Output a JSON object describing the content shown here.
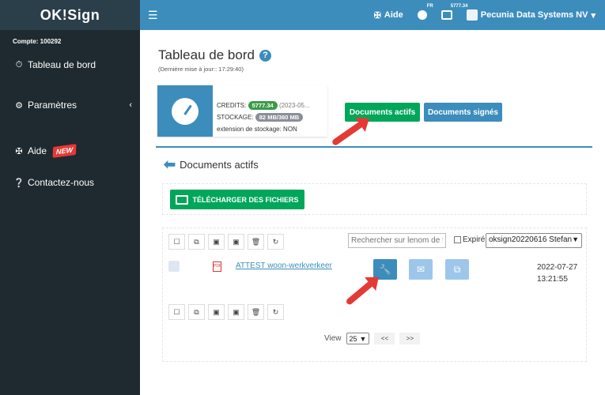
{
  "brand": "OK!Sign",
  "topbar": {
    "menu_icon": "hamburger-icon",
    "help_label": "Aide",
    "lang_sup": "FR",
    "credits_sup": "5777.34",
    "org_name": "Pecunia Data Systems NV"
  },
  "sidebar": {
    "account": "Compte: 100292",
    "items": [
      {
        "label": "Tableau de bord",
        "icon": "dashboard-icon"
      },
      {
        "label": "Paramètres",
        "icon": "gears-icon"
      },
      {
        "label": "Aide",
        "icon": "signpost-icon",
        "badge": "NEW"
      },
      {
        "label": "Contactez-nous",
        "icon": "question-icon"
      }
    ]
  },
  "main": {
    "title": "Tableau de bord",
    "updated": "(Dernière mise à jour:: 17:29:40)",
    "info": {
      "credits_label": "CREDITS:",
      "credits_value": "5777.34",
      "credits_date": "(2023-05...",
      "storage_label": "STOCKAGE:",
      "storage_value": "82 MB/360 MB",
      "extension": "extension de stockage: NON"
    },
    "btn_active": "Documents actifs",
    "btn_signed": "Documents signés",
    "section_title": "Documents actifs",
    "download_label": "TÉLÉCHARGER DES FICHIERS",
    "search_placeholder": "Rechercher sur lenom de fi",
    "expire_label": "Expiré",
    "select_value": "oksign20220616 Stefan",
    "row": {
      "doc_name": "ATTEST woon-werkverkeer",
      "date": "2022-07-27",
      "time": "13:21:55"
    },
    "pager": {
      "view_label": "View",
      "page_size": "25",
      "prev": "<<",
      "next": ">>"
    }
  },
  "colors": {
    "accent": "#3c8dbc",
    "success": "#00a65a",
    "sidebar": "#1e2a2f",
    "annotation": "#e53935"
  }
}
